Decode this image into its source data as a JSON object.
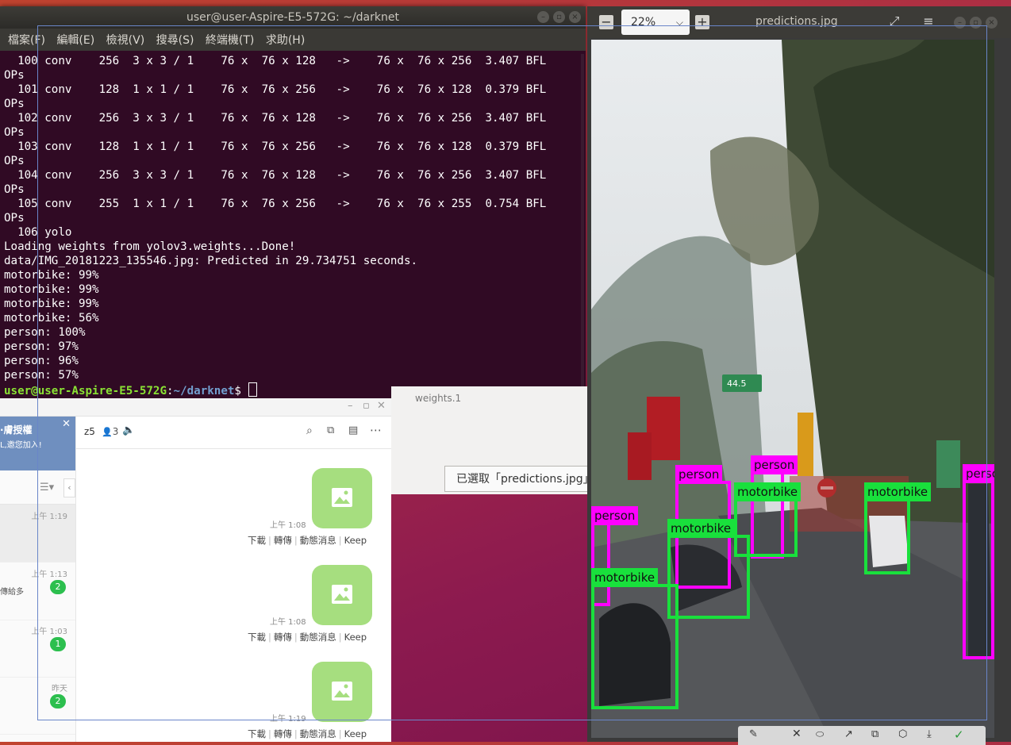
{
  "terminal": {
    "title": "user@user-Aspire-E5-572G: ~/darknet",
    "menu": [
      "檔案(F)",
      "編輯(E)",
      "檢視(V)",
      "搜尋(S)",
      "終端機(T)",
      "求助(H)"
    ],
    "lines": [
      "  100 conv    256  3 x 3 / 1    76 x  76 x 128   ->    76 x  76 x 256  3.407 BFL",
      "OPs",
      "  101 conv    128  1 x 1 / 1    76 x  76 x 256   ->    76 x  76 x 128  0.379 BFL",
      "OPs",
      "  102 conv    256  3 x 3 / 1    76 x  76 x 128   ->    76 x  76 x 256  3.407 BFL",
      "OPs",
      "  103 conv    128  1 x 1 / 1    76 x  76 x 256   ->    76 x  76 x 128  0.379 BFL",
      "OPs",
      "  104 conv    256  3 x 3 / 1    76 x  76 x 128   ->    76 x  76 x 256  3.407 BFL",
      "OPs",
      "  105 conv    255  1 x 1 / 1    76 x  76 x 256   ->    76 x  76 x 255  0.754 BFL",
      "OPs",
      "  106 yolo",
      "Loading weights from yolov3.weights...Done!",
      "data/IMG_20181223_135546.jpg: Predicted in 29.734751 seconds.",
      "motorbike: 99%",
      "motorbike: 99%",
      "motorbike: 99%",
      "motorbike: 56%",
      "person: 100%",
      "person: 97%",
      "person: 96%",
      "person: 57%"
    ],
    "prompt_user": "user@user-Aspire-E5-572G",
    "prompt_sep": ":",
    "prompt_path": "~/darknet",
    "prompt_end": "$ "
  },
  "background_window": {
    "caption": "weights.1",
    "selected_text": "已選取「predictions.jpg」"
  },
  "chat": {
    "banner_title": "·膚授權",
    "banner_sub": "L,邀您加入!",
    "room_name": "z5",
    "member_count": "3",
    "list": [
      {
        "time": "上午 1:19",
        "preview": "",
        "badge": ""
      },
      {
        "time": "上午 1:13",
        "preview": "傳給多",
        "badge": "2"
      },
      {
        "time": "上午 1:03",
        "preview": "",
        "badge": "1"
      },
      {
        "time": "昨天",
        "preview": "",
        "badge": "2"
      }
    ],
    "messages": [
      {
        "time": "上午 1:08"
      },
      {
        "time": "上午 1:08"
      },
      {
        "time": "上午 1:19"
      }
    ],
    "actions": [
      "下載",
      "轉傳",
      "動態消息",
      "Keep"
    ]
  },
  "viewer": {
    "zoom": "22%",
    "title": "predictions.jpg",
    "sign_text": "44.5",
    "detections": [
      {
        "label": "person",
        "color": "#ff00ff"
      },
      {
        "label": "person",
        "color": "#ff00ff"
      },
      {
        "label": "person",
        "color": "#ff00ff"
      },
      {
        "label": "person",
        "color": "#ff00ff"
      },
      {
        "label": "motorbike",
        "color": "#19e03c"
      },
      {
        "label": "motorbike",
        "color": "#19e03c"
      },
      {
        "label": "motorbike",
        "color": "#19e03c"
      },
      {
        "label": "motorbike",
        "color": "#19e03c"
      }
    ]
  }
}
